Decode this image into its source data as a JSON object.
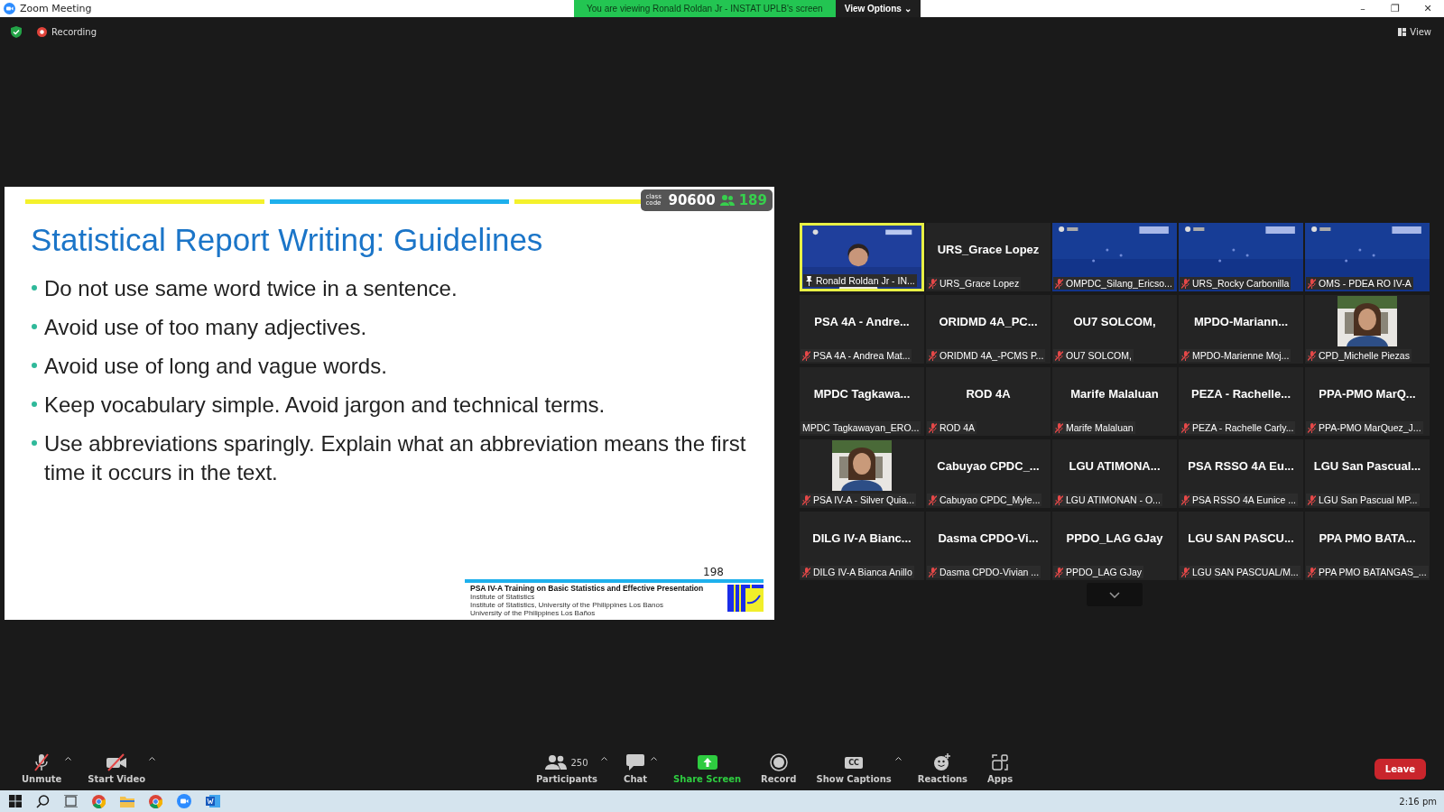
{
  "window": {
    "title": "Zoom Meeting",
    "controls": [
      "–",
      "❐",
      "✕"
    ]
  },
  "share_banner": {
    "text": "You are viewing Ronald Roldan Jr - INSTAT UPLB's screen",
    "options": "View Options ⌄"
  },
  "top_bar": {
    "recording": "Recording",
    "view": "View"
  },
  "slide": {
    "title": "Statistical Report Writing: Guidelines",
    "bullets": [
      "Do not use same word twice in a sentence.",
      "Avoid use of too many adjectives.",
      "Avoid use of long and vague words.",
      "Keep vocabulary simple. Avoid jargon and technical terms.",
      "Use abbreviations sparingly. Explain what an abbreviation means the first time it occurs in the text."
    ],
    "class_code_label": "class code",
    "class_code": "90600",
    "attendees": "189",
    "footer_lines": [
      "PSA IV-A Training on Basic Statistics and Effective Presentation",
      "Institute of Statistics, University of the Philippines Los Banos"
    ],
    "footer_overlay": [
      "Institute of Statistics",
      "University of the Philippines Los Baños"
    ],
    "page_number": "198"
  },
  "tiles": [
    {
      "kind": "video",
      "name": "Ronald Roldan Jr - IN...",
      "muted": false,
      "pinned": true,
      "active": true
    },
    {
      "kind": "name",
      "title": "URS_Grace Lopez",
      "name": "URS_Grace Lopez",
      "muted": true,
      "pinned": false,
      "active": false
    },
    {
      "kind": "screen",
      "name": "OMPDC_Silang_Ericso...",
      "muted": true,
      "pinned": false,
      "active": false
    },
    {
      "kind": "screen",
      "name": "URS_Rocky Carbonilla",
      "muted": true,
      "pinned": false,
      "active": false
    },
    {
      "kind": "screen",
      "name": "OMS - PDEA RO IV-A",
      "muted": true,
      "pinned": false,
      "active": false
    },
    {
      "kind": "name",
      "title": "PSA 4A - Andre...",
      "name": "PSA 4A - Andrea Mat...",
      "muted": true,
      "pinned": false,
      "active": false
    },
    {
      "kind": "name",
      "title": "ORIDMD 4A_PC...",
      "name": "ORIDMD 4A_-PCMS P...",
      "muted": true,
      "pinned": false,
      "active": false
    },
    {
      "kind": "name",
      "title": "OU7 SOLCOM,",
      "name": "OU7 SOLCOM,",
      "muted": true,
      "pinned": false,
      "active": false
    },
    {
      "kind": "name",
      "title": "MPDO-Mariann...",
      "name": "MPDO-Marienne Moj...",
      "muted": true,
      "pinned": false,
      "active": false
    },
    {
      "name": "CPD_Michelle Piezas",
      "muted": true,
      "pinned": false,
      "active": false
    },
    {
      "kind": "name",
      "title": "MPDC Tagkawa...",
      "name": "MPDC Tagkawayan_ERO...",
      "muted": false,
      "pinned": false,
      "active": false
    },
    {
      "kind": "name",
      "title": "ROD 4A",
      "name": "ROD 4A",
      "muted": true,
      "pinned": false,
      "active": false
    },
    {
      "kind": "name",
      "title": "Marife Malaluan",
      "name": "Marife Malaluan",
      "muted": true,
      "pinned": false,
      "active": false
    },
    {
      "kind": "name",
      "title": "PEZA - Rachelle...",
      "name": "PEZA - Rachelle Carly...",
      "muted": true,
      "pinned": false,
      "active": false
    },
    {
      "kind": "name",
      "title": "PPA-PMO MarQ...",
      "name": "PPA-PMO MarQuez_J...",
      "muted": true,
      "pinned": false,
      "active": false
    },
    {
      "name": "PSA IV-A - Silver Quia...",
      "muted": true,
      "pinned": false,
      "active": false
    },
    {
      "kind": "name",
      "title": "Cabuyao CPDC_...",
      "name": "Cabuyao CPDC_Myle...",
      "muted": true,
      "pinned": false,
      "active": false
    },
    {
      "kind": "name",
      "title": "LGU ATIMONA...",
      "name": "LGU ATIMONAN - O...",
      "muted": true,
      "pinned": false,
      "active": false
    },
    {
      "kind": "name",
      "title": "PSA RSSO 4A Eu...",
      "name": "PSA RSSO 4A Eunice ...",
      "muted": true,
      "pinned": false,
      "active": false
    },
    {
      "kind": "name",
      "title": "LGU San Pascual...",
      "name": "LGU San Pascual MP...",
      "muted": true,
      "pinned": false,
      "active": false
    },
    {
      "kind": "name",
      "title": "DILG IV-A Bianc...",
      "name": "DILG IV-A Bianca Anillo",
      "muted": true,
      "pinned": false,
      "active": false
    },
    {
      "kind": "name",
      "title": "Dasma CPDO-Vi...",
      "name": "Dasma CPDO-Vivian ...",
      "muted": true,
      "pinned": false,
      "active": false
    },
    {
      "kind": "name",
      "title": "PPDO_LAG GJay",
      "name": "PPDO_LAG GJay",
      "muted": true,
      "pinned": false,
      "active": false
    },
    {
      "kind": "name",
      "title": "LGU SAN PASCU...",
      "name": "LGU SAN PASCUAL/M...",
      "muted": true,
      "pinned": false,
      "active": false
    },
    {
      "kind": "name",
      "title": "PPA PMO BATA...",
      "name": "PPA PMO BATANGAS_...",
      "muted": true,
      "pinned": false,
      "active": false
    }
  ],
  "toolbar": [
    {
      "kind": "mic",
      "label": "Unmute",
      "caret": true
    },
    {
      "kind": "video",
      "label": "Start Video",
      "caret": true
    },
    {
      "kind": "participants",
      "label": "Participants",
      "count": "250",
      "caret": true
    },
    {
      "kind": "chat",
      "label": "Chat",
      "caret": true
    },
    {
      "kind": "share",
      "label": "Share Screen",
      "caret": false
    },
    {
      "kind": "record",
      "label": "Record",
      "caret": false
    },
    {
      "kind": "captions",
      "label": "Show Captions",
      "glyph": "CC",
      "caret": true
    },
    {
      "kind": "reactions",
      "label": "Reactions",
      "caret": false
    },
    {
      "kind": "apps",
      "label": "Apps",
      "caret": false
    }
  ],
  "leave": "Leave",
  "taskbar": {
    "time": "2:16 pm"
  }
}
